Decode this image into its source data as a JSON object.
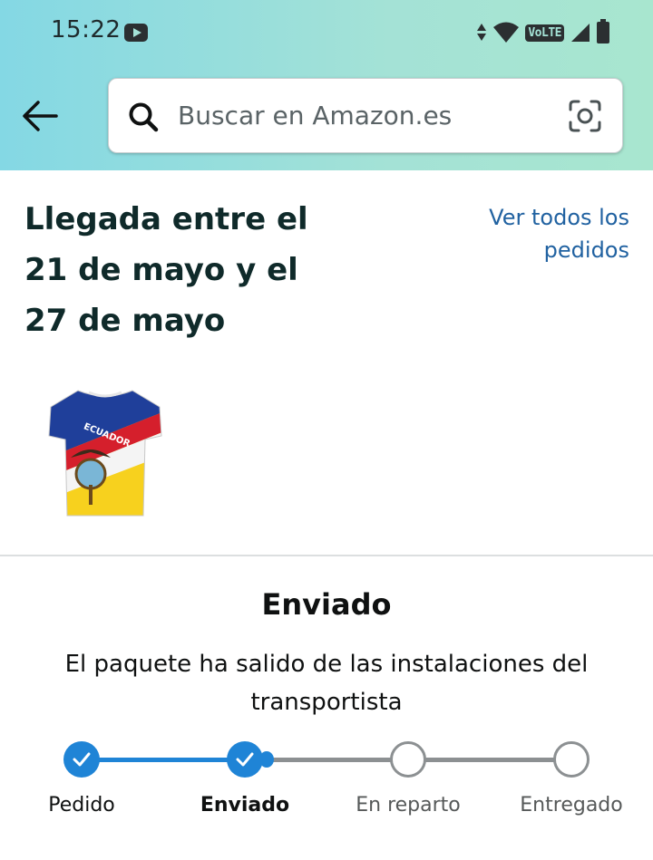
{
  "status_bar": {
    "time": "15:22",
    "network_label": "VoLTE",
    "icons": [
      "youtube-icon",
      "data-arrows-icon",
      "wifi-icon",
      "signal-icon",
      "battery-icon"
    ]
  },
  "header": {
    "back_icon": "arrow-left-icon",
    "search": {
      "placeholder": "Buscar en Amazon.es",
      "value": ""
    },
    "camera_icon": "camera-lens-icon"
  },
  "arrival": {
    "title": "Llegada entre el 21 de mayo y el 27 de mayo",
    "view_all_link": "Ver todos los pedidos"
  },
  "product": {
    "image_icon": "tshirt-image",
    "print_text": "ECUADOR"
  },
  "shipment": {
    "status": "Enviado",
    "description": "El paquete ha salido de las instalaciones del transportista",
    "steps": [
      {
        "label": "Pedido",
        "done": true
      },
      {
        "label": "Enviado",
        "done": true
      },
      {
        "label": "En reparto",
        "done": false
      },
      {
        "label": "Entregado",
        "done": false
      }
    ]
  },
  "colors": {
    "header_gradient_start": "#84d8e4",
    "header_gradient_end": "#a8e6cf",
    "link": "#2162a1",
    "progress_done": "#1f84d6",
    "progress_todo": "#8c9092"
  }
}
